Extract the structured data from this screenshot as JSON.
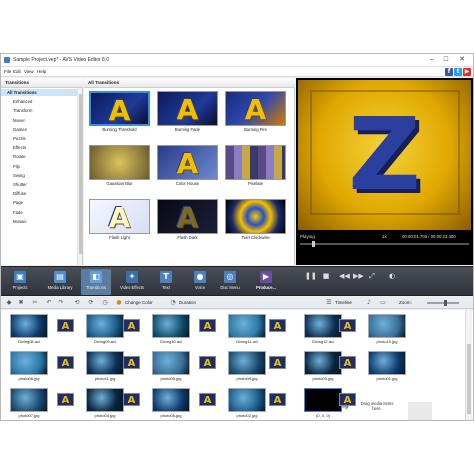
{
  "window": {
    "title": "Sample Project.vep* - AVS Video Editor 8.0",
    "minimize": "–",
    "maximize": "☐",
    "close": "✕"
  },
  "menu": [
    "File",
    "Edit",
    "View",
    "Help"
  ],
  "social": [
    {
      "icon": "facebook-icon",
      "glyph": "f",
      "color": "#3b5998"
    },
    {
      "icon": "twitter-icon",
      "glyph": "t",
      "color": "#1da1f2"
    },
    {
      "icon": "youtube-icon",
      "glyph": "▶",
      "color": "#e52d27"
    }
  ],
  "tree": {
    "header": "Transitions",
    "items": [
      "All Transitions",
      "Enhanced",
      "Transform",
      "Mover",
      "Games",
      "Puzzle",
      "Effects",
      "Rotate",
      "Flip",
      "Swing",
      "Shutter",
      "Diffuse",
      "Page",
      "Fade",
      "Mosaic"
    ],
    "selected_index": 0
  },
  "transitions": {
    "header": "All Transitions",
    "items": [
      {
        "name": "Burning Threshold",
        "selected": true,
        "style": "a-burn"
      },
      {
        "name": "Burning Fade",
        "selected": false,
        "style": "a-burn"
      },
      {
        "name": "Burning Fire",
        "selected": false,
        "style": "a-fire"
      },
      {
        "name": "Gaussian Blur",
        "selected": false,
        "style": "blur"
      },
      {
        "name": "Color House",
        "selected": false,
        "style": "a-color"
      },
      {
        "name": "Pixelate",
        "selected": false,
        "style": "pixel"
      },
      {
        "name": "Flash Light",
        "selected": false,
        "style": "a-light"
      },
      {
        "name": "Flash Dark",
        "selected": false,
        "style": "a-dark"
      },
      {
        "name": "Twirl Clockwise",
        "selected": false,
        "style": "twirl"
      }
    ]
  },
  "preview": {
    "letter": "Z",
    "status": "Playing",
    "speed": "1x",
    "time": "00:00:01.700 / 00:00:23.400",
    "progress": 0.07
  },
  "toolbar": {
    "tools": [
      {
        "label": "Projects",
        "icon": "projects-icon",
        "glyph": "▣",
        "color": "#3d7fc1",
        "active": false
      },
      {
        "label": "Media Library",
        "icon": "media-library-icon",
        "glyph": "▤",
        "color": "#4e8fd0",
        "active": false
      },
      {
        "label": "Transitions",
        "icon": "transitions-icon",
        "glyph": "◧",
        "color": "#6aa0d8",
        "active": true
      },
      {
        "label": "Video Effects",
        "icon": "video-effects-icon",
        "glyph": "✦",
        "color": "#3e6fa6",
        "active": false
      },
      {
        "label": "Text",
        "icon": "text-icon",
        "glyph": "T",
        "color": "#4b82bd",
        "active": false
      },
      {
        "label": "Voice",
        "icon": "voice-icon",
        "glyph": "●",
        "color": "#4b82bd",
        "active": false
      },
      {
        "label": "Disc Menu",
        "icon": "disc-menu-icon",
        "glyph": "◎",
        "color": "#4b82bd",
        "active": false
      },
      {
        "label": "Produce...",
        "icon": "produce-icon",
        "glyph": "▶",
        "color": "#6b4ea0",
        "active": false
      }
    ],
    "playback": [
      "❚❚",
      "■",
      "◀◀",
      "▶▶",
      "⤢",
      "◐"
    ]
  },
  "storyboard_tools": {
    "change_color": "Change Color",
    "duration": "Duration",
    "timeline": "Timeline",
    "zoom": "Zoom:",
    "zoom_level": 0.6
  },
  "storyboard": {
    "row1": [
      "Diving08.avi",
      "Diving09.avi",
      "Diving10.avi",
      "Diving11.avi",
      "Diving12.avi",
      "photo10.jpg"
    ],
    "row2": [
      "photo08.jpg",
      "photo11.jpg",
      "photo05.jpg",
      "photo09.jpg",
      "photo03.jpg",
      "photo01.jpg"
    ],
    "row3": [
      "photo07.jpg",
      "photo04.jpg",
      "photo06.jpg",
      "photo02.jpg",
      "(0, 0, 0)"
    ],
    "drop_text": "Drag media items here.",
    "transition_letter": "A"
  }
}
